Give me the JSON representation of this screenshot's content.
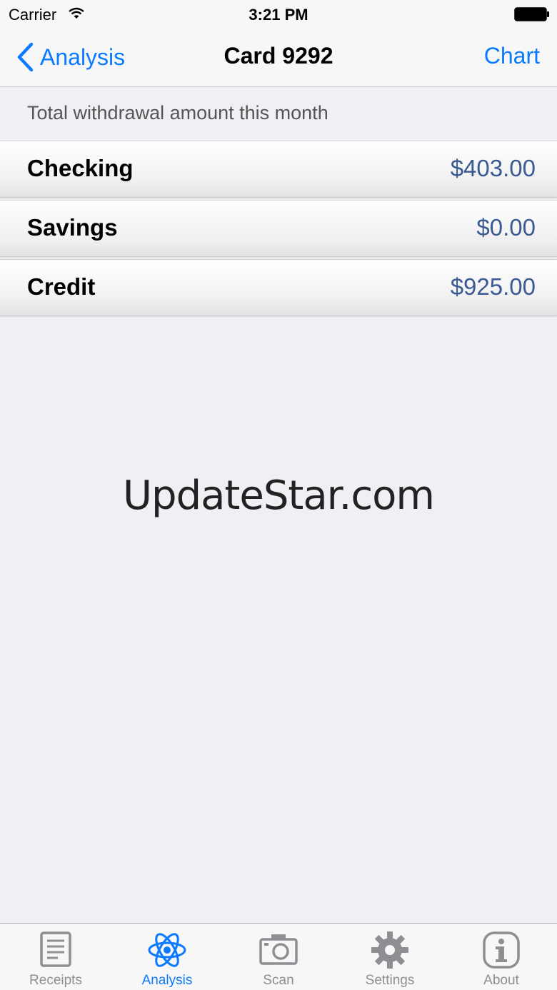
{
  "status_bar": {
    "carrier": "Carrier",
    "time": "3:21 PM"
  },
  "nav": {
    "back_label": "Analysis",
    "title": "Card 9292",
    "right_button": "Chart"
  },
  "section_header": "Total withdrawal amount this month",
  "rows": [
    {
      "label": "Checking",
      "value": "$403.00"
    },
    {
      "label": "Savings",
      "value": "$0.00"
    },
    {
      "label": "Credit",
      "value": "$925.00"
    }
  ],
  "watermark": "UpdateStar.com",
  "tabs": [
    {
      "label": "Receipts",
      "icon": "receipt-icon",
      "active": false
    },
    {
      "label": "Analysis",
      "icon": "atom-icon",
      "active": true
    },
    {
      "label": "Scan",
      "icon": "camera-icon",
      "active": false
    },
    {
      "label": "Settings",
      "icon": "gear-icon",
      "active": false
    },
    {
      "label": "About",
      "icon": "info-icon",
      "active": false
    }
  ],
  "colors": {
    "accent": "#0a7aff",
    "value_text": "#3b5a91",
    "background": "#efeff4",
    "inactive_tab": "#8e8e93"
  }
}
